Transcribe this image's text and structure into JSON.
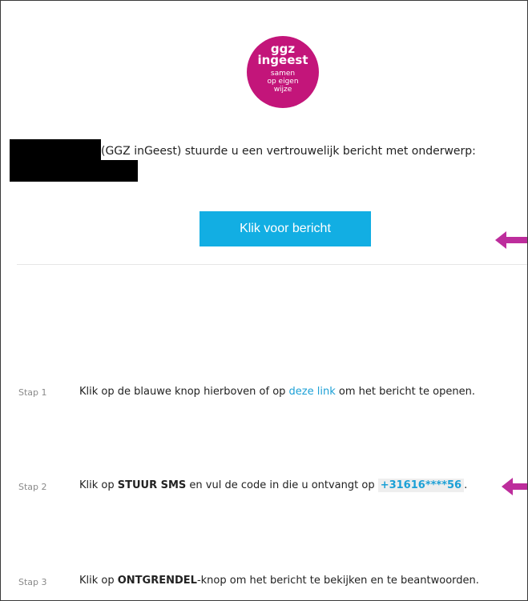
{
  "logo": {
    "line1": "ggz",
    "line2": "ingeest",
    "line3": "samen",
    "line4": "op eigen",
    "line5": "wijze",
    "color": "#c3157a"
  },
  "message": {
    "sender_suffix": "(GGZ inGeest) stuurde u een vertrouwelijk bericht met onderwerp:"
  },
  "cta": {
    "label": "Klik voor bericht",
    "color": "#12aee3"
  },
  "arrow_color": "#bd2d9c",
  "steps": [
    {
      "label": "Stap 1",
      "text_before": "Klik op de blauwe knop hierboven of op ",
      "link_text": "deze link",
      "text_after": " om het bericht te openen."
    },
    {
      "label": "Stap 2",
      "text_before": "Klik op ",
      "bold": "STUUR SMS",
      "text_middle": " en vul de code in die u ontvangt op ",
      "phone": "+31616****56",
      "text_after": "."
    },
    {
      "label": "Stap 3",
      "text_before": "Klik op ",
      "bold": "ONTGRENDEL",
      "text_after": "-knop om het bericht te bekijken en te beantwoorden."
    }
  ]
}
